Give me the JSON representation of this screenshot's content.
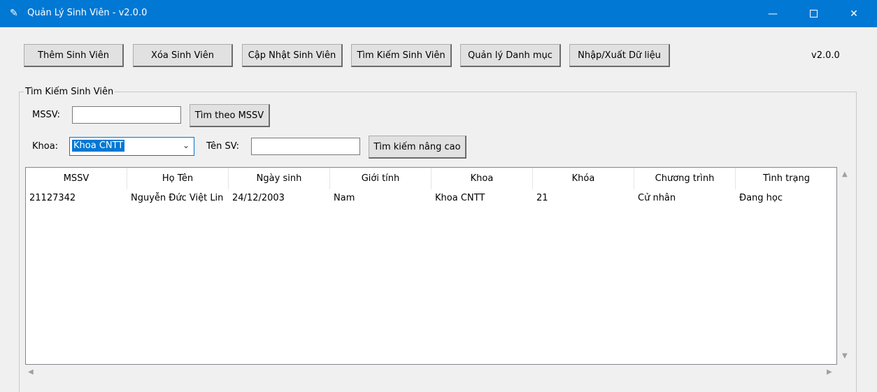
{
  "window": {
    "title": "Quản Lý Sinh Viên - v2.0.0",
    "icon": "feather-icon",
    "minimize": "—",
    "close": "✕"
  },
  "toolbar": {
    "add": "Thêm Sinh Viên",
    "delete": "Xóa Sinh Viên",
    "update": "Cập Nhật Sinh Viên",
    "search": "Tìm Kiếm Sinh Viên",
    "catalog": "Quản lý Danh mục",
    "import_export": "Nhập/Xuất Dữ liệu",
    "version": "v2.0.0"
  },
  "search": {
    "group_title": "Tìm Kiếm Sinh Viên",
    "mssv_label": "MSSV:",
    "mssv_value": "",
    "mssv_button": "Tìm theo MSSV",
    "khoa_label": "Khoa:",
    "khoa_selected": "Khoa CNTT",
    "ten_label": "Tên SV:",
    "ten_value": "",
    "advanced_button": "Tìm kiếm nâng cao"
  },
  "table": {
    "columns": [
      "MSSV",
      "Họ Tên",
      "Ngày sinh",
      "Giới tính",
      "Khoa",
      "Khóa",
      "Chương trình",
      "Tình trạng"
    ],
    "rows": [
      [
        "21127342",
        "Nguyễn Đức Việt Lin",
        "24/12/2003",
        "Nam",
        "Khoa CNTT",
        "21",
        "Cử nhân",
        "Đang học"
      ]
    ]
  },
  "colors": {
    "titlebar": "#0078d4",
    "selection": "#0078d4",
    "background": "#f0f0f0"
  }
}
